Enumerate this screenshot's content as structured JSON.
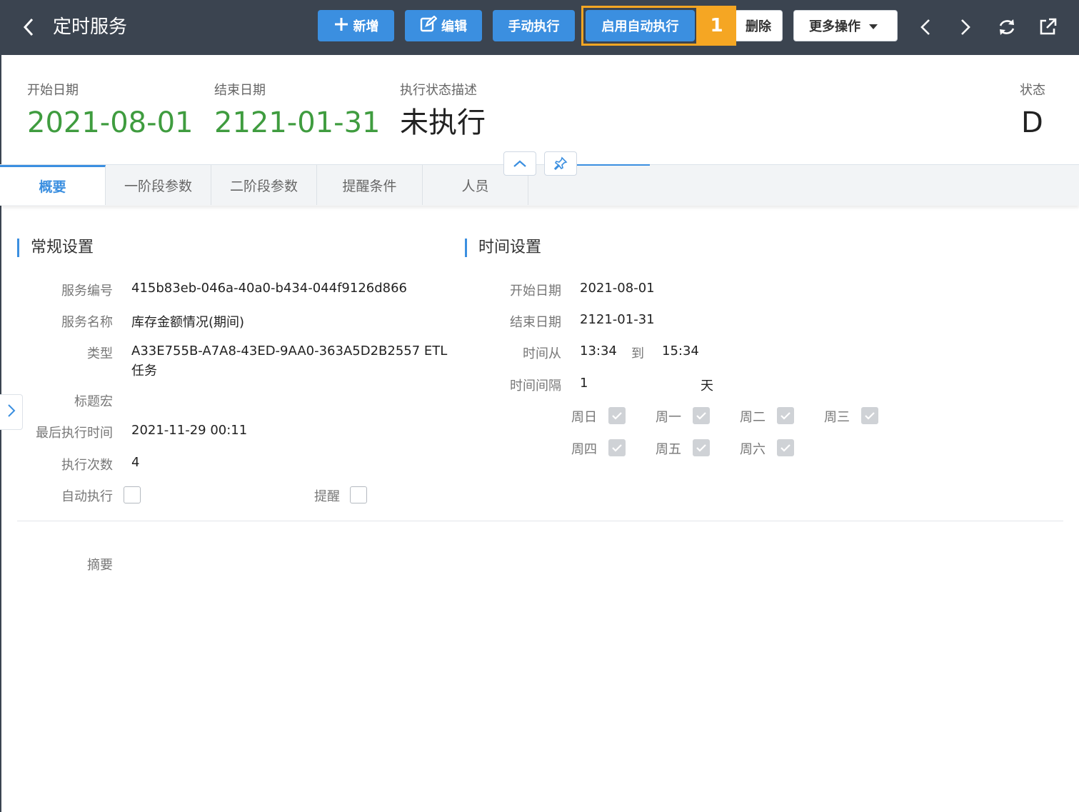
{
  "header": {
    "title": "定时服务",
    "buttons": {
      "add": "新增",
      "edit": "编辑",
      "manual_run": "手动执行",
      "enable_auto": "启用自动执行",
      "delete": "删除",
      "more": "更多操作"
    },
    "marker": "1"
  },
  "summary": {
    "start_date_label": "开始日期",
    "start_date": "2021-08-01",
    "end_date_label": "结束日期",
    "end_date": "2121-01-31",
    "exec_status_label": "执行状态描述",
    "exec_status": "未执行",
    "status_label": "状态",
    "status": "D"
  },
  "tabs": [
    {
      "label": "概要",
      "active": true
    },
    {
      "label": "一阶段参数",
      "active": false
    },
    {
      "label": "二阶段参数",
      "active": false
    },
    {
      "label": "提醒条件",
      "active": false
    },
    {
      "label": "人员",
      "active": false
    }
  ],
  "general": {
    "title": "常规设置",
    "service_no_label": "服务编号",
    "service_no": "415b83eb-046a-40a0-b434-044f9126d866",
    "service_name_label": "服务名称",
    "service_name": "库存金额情况(期间)",
    "type_label": "类型",
    "type_line1": "A33E755B-A7A8-43ED-9AA0-363A5D2B2557 ETL",
    "type_line2": "任务",
    "title_macro_label": "标题宏",
    "last_exec_label": "最后执行时间",
    "last_exec": "2021-11-29 00:11",
    "exec_count_label": "执行次数",
    "exec_count": "4",
    "auto_exec_label": "自动执行",
    "auto_exec_checked": false,
    "remind_label": "提醒",
    "remind_checked": false
  },
  "time": {
    "title": "时间设置",
    "start_date_label": "开始日期",
    "start_date": "2021-08-01",
    "end_date_label": "结束日期",
    "end_date": "2121-01-31",
    "time_from_label": "时间从",
    "time_from": "13:34",
    "to_label": "到",
    "time_to": "15:34",
    "interval_label": "时间间隔",
    "interval": "1",
    "interval_unit": "天",
    "weekdays": [
      {
        "label": "周日",
        "checked": true
      },
      {
        "label": "周一",
        "checked": true
      },
      {
        "label": "周二",
        "checked": true
      },
      {
        "label": "周三",
        "checked": true
      },
      {
        "label": "周四",
        "checked": true
      },
      {
        "label": "周五",
        "checked": true
      },
      {
        "label": "周六",
        "checked": true
      }
    ]
  },
  "summary_section": {
    "label": "摘要"
  },
  "colors": {
    "topbar": "#3b4450",
    "primary": "#3b8fe0",
    "highlight": "#f5a623",
    "green": "#3f9c3f"
  },
  "icons": {
    "back": "chevron-left-icon",
    "add": "plus-icon",
    "edit": "edit-icon",
    "more": "caret-down-icon",
    "prev": "chevron-left-icon",
    "next": "chevron-right-icon",
    "refresh": "refresh-icon",
    "share": "external-link-icon",
    "collapse": "chevron-up-icon",
    "pin": "pin-icon",
    "side": "chevron-right-icon"
  }
}
